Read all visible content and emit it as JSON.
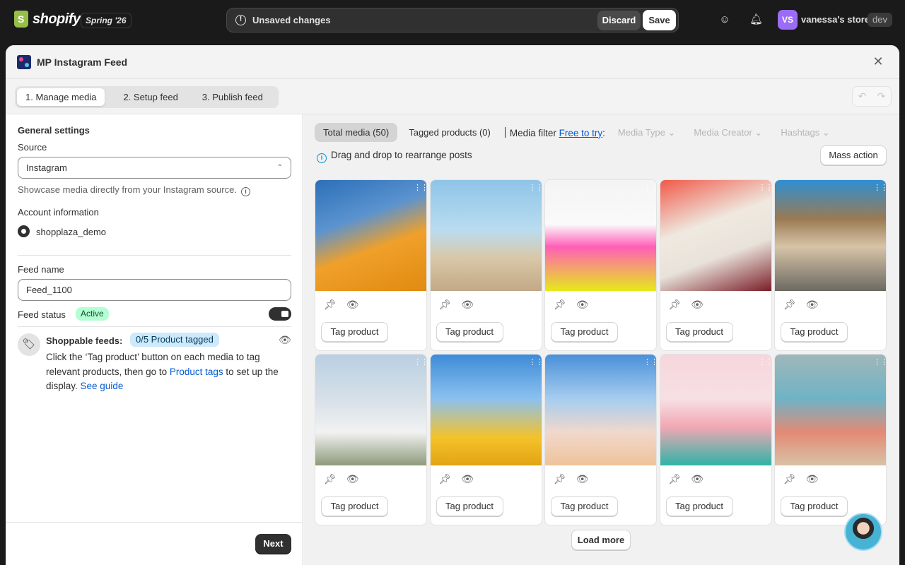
{
  "topbar": {
    "brand": "shopify",
    "edition": "Spring '26",
    "unsaved_label": "Unsaved changes",
    "discard_label": "Discard",
    "save_label": "Save",
    "avatar_initials": "VS",
    "store_name": "vanessa's store",
    "store_badge": "dev"
  },
  "modal": {
    "title": "MP Instagram Feed",
    "steps": [
      "1. Manage media",
      "2. Setup feed",
      "3. Publish feed"
    ]
  },
  "left": {
    "section_title": "General settings",
    "source_label": "Source",
    "source_value": "Instagram",
    "source_help": "Showcase media directly from your Instagram source.",
    "account_label": "Account information",
    "account_name": "shopplaza_demo",
    "feed_name_label": "Feed name",
    "feed_name_value": "Feed_1100",
    "feed_status_label": "Feed status",
    "feed_status_badge": "Active",
    "shoppable_title": "Shoppable feeds:",
    "shoppable_badge": "0/5 Product tagged",
    "shoppable_desc_1": "Click the ‘Tag product’ button on each media to tag relevant products, then go to ",
    "shoppable_link_1": "Product tags",
    "shoppable_desc_2": " to set up the display. ",
    "shoppable_link_2": "See guide",
    "next_label": "Next"
  },
  "right": {
    "tabs": [
      "Total media (50)",
      "Tagged products (0)"
    ],
    "media_filter_label": "Media filter",
    "free_to_try": "Free to try",
    "filters": [
      "Media Type",
      "Media Creator",
      "Hashtags"
    ],
    "dnd_text": "Drag and drop to rearrange posts",
    "mass_action": "Mass action",
    "tag_product_label": "Tag product",
    "load_more": "Load more"
  },
  "colors": {
    "accent_link": "#005bd3",
    "active_badge_bg": "#b4fed2",
    "info_badge_bg": "#cde9fb",
    "primary_button": "#303030"
  },
  "media": [
    {
      "bg": "linear-gradient(160deg,#2c6fb8 0%,#5b93cf 35%,#f0a02a 60%,#e08a10 100%)"
    },
    {
      "bg": "linear-gradient(180deg,#8fc4e8 0%,#b9dcef 45%,#d9c8a8 70%,#c2a886 100%)"
    },
    {
      "bg": "linear-gradient(180deg,#f4f4f4 0%,#fafafa 40%,#ff5fb8 60%,#e6ea1a 100%)"
    },
    {
      "bg": "linear-gradient(160deg,#f05a4a 0%,#efe9e0 40%,#e8e2da 65%,#7a1e28 100%)"
    },
    {
      "bg": "linear-gradient(180deg,#2e8fd3 0%,#9a7a52 35%,#d7c4a8 60%,#6c6a62 100%)"
    },
    {
      "bg": "linear-gradient(180deg,#b9cfe2 0%,#d6e0e8 40%,#f2f2f2 70%,#8d9a7a 100%)"
    },
    {
      "bg": "linear-gradient(180deg,#3d8bd8 0%,#8cc1ef 40%,#f5c22a 75%,#e2a414 100%)"
    },
    {
      "bg": "linear-gradient(180deg,#4a90d9 0%,#a6cdef 40%,#f1d8cc 70%,#efc39a 100%)"
    },
    {
      "bg": "linear-gradient(180deg,#f6d6dd 0%,#f7e0e4 40%,#f2a8b4 65%,#2fb3a8 100%)"
    },
    {
      "bg": "linear-gradient(180deg,#9fb7b9 0%,#6fb3c6 40%,#e38a75 70%,#d8c2a6 100%)"
    }
  ]
}
